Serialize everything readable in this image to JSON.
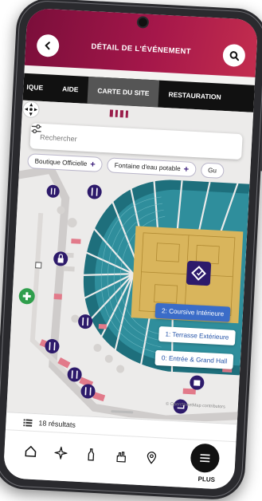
{
  "header": {
    "title": "DÉTAIL DE L'ÉVÉNEMENT"
  },
  "tabs": [
    {
      "label": "IQUE",
      "active": false
    },
    {
      "label": "AIDE",
      "active": false
    },
    {
      "label": "CARTE DU SITE",
      "active": true
    },
    {
      "label": "RESTAURATION",
      "active": false
    }
  ],
  "map": {
    "search_placeholder": "Rechercher",
    "chips": [
      {
        "label": "Boutique Officielle"
      },
      {
        "label": "Fontaine d'eau potable"
      },
      {
        "label": "Gu"
      }
    ],
    "levels": [
      {
        "label": "2: Coursive Intérieure",
        "active": true
      },
      {
        "label": "1: Terrasse Extérieure",
        "active": false
      },
      {
        "label": "0: Entrée & Grand Hall",
        "active": false
      }
    ],
    "attribution": "© OpenStreetMap contributors"
  },
  "results": {
    "text": "18 résultats"
  },
  "bottom_nav": {
    "items": [
      {
        "icon": "home-icon"
      },
      {
        "icon": "sparkle-icon"
      },
      {
        "icon": "bottle-icon"
      },
      {
        "icon": "hand-icon"
      },
      {
        "icon": "location-pin-icon"
      }
    ],
    "plus_label": "PLUS"
  },
  "colors": {
    "header_start": "#7a0e3a",
    "header_end": "#c32d4e",
    "accent_purple": "#3b1d7a",
    "seats_teal": "#2f8e9c",
    "court_yellow": "#d9b55c",
    "level_active": "#3a6cc8"
  }
}
